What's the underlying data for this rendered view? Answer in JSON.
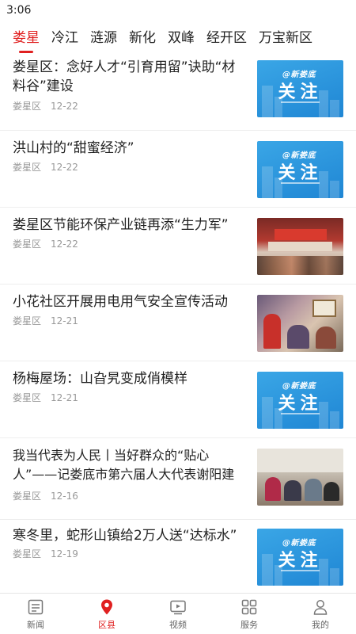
{
  "status": {
    "time": "3:06"
  },
  "tabs": [
    {
      "label": "娄星",
      "active": true
    },
    {
      "label": "冷江"
    },
    {
      "label": "涟源"
    },
    {
      "label": "新化"
    },
    {
      "label": "双峰"
    },
    {
      "label": "经开区"
    },
    {
      "label": "万宝新区"
    }
  ],
  "follow_card": {
    "brand": "@新娄底",
    "text": "关注"
  },
  "news": [
    {
      "title": "娄星区：念好人才“引育用留”诀助“材料谷”建设",
      "source": "娄星区",
      "date": "12-22",
      "thumb": "follow"
    },
    {
      "title": "洪山村的“甜蜜经济”",
      "source": "娄星区",
      "date": "12-22",
      "thumb": "follow"
    },
    {
      "title": "娄星区节能环保产业链再添“生力军”",
      "source": "娄星区",
      "date": "12-22",
      "thumb": "photo-event"
    },
    {
      "title": "小花社区开展用电用气安全宣传活动",
      "source": "娄星区",
      "date": "12-21",
      "thumb": "photo-room"
    },
    {
      "title": "杨梅屋场：山旮旯变成俏模样",
      "source": "娄星区",
      "date": "12-21",
      "thumb": "follow"
    },
    {
      "title": "我当代表为人民丨当好群众的“贴心人”——记娄底市第六届人大代表谢阳建",
      "source": "娄星区",
      "date": "12-16",
      "thumb": "photo-meeting"
    },
    {
      "title": "寒冬里，蛇形山镇给2万人送“达标水”",
      "source": "娄星区",
      "date": "12-19",
      "thumb": "follow"
    }
  ],
  "bottom_nav": [
    {
      "label": "新闻",
      "icon": "news-icon"
    },
    {
      "label": "区县",
      "icon": "location-pin-icon",
      "active": true
    },
    {
      "label": "视频",
      "icon": "video-icon"
    },
    {
      "label": "服务",
      "icon": "grid-icon"
    },
    {
      "label": "我的",
      "icon": "user-icon"
    }
  ],
  "colors": {
    "accent": "#e02020",
    "follow_blue": "#2a95dd",
    "meta_gray": "#999999"
  }
}
